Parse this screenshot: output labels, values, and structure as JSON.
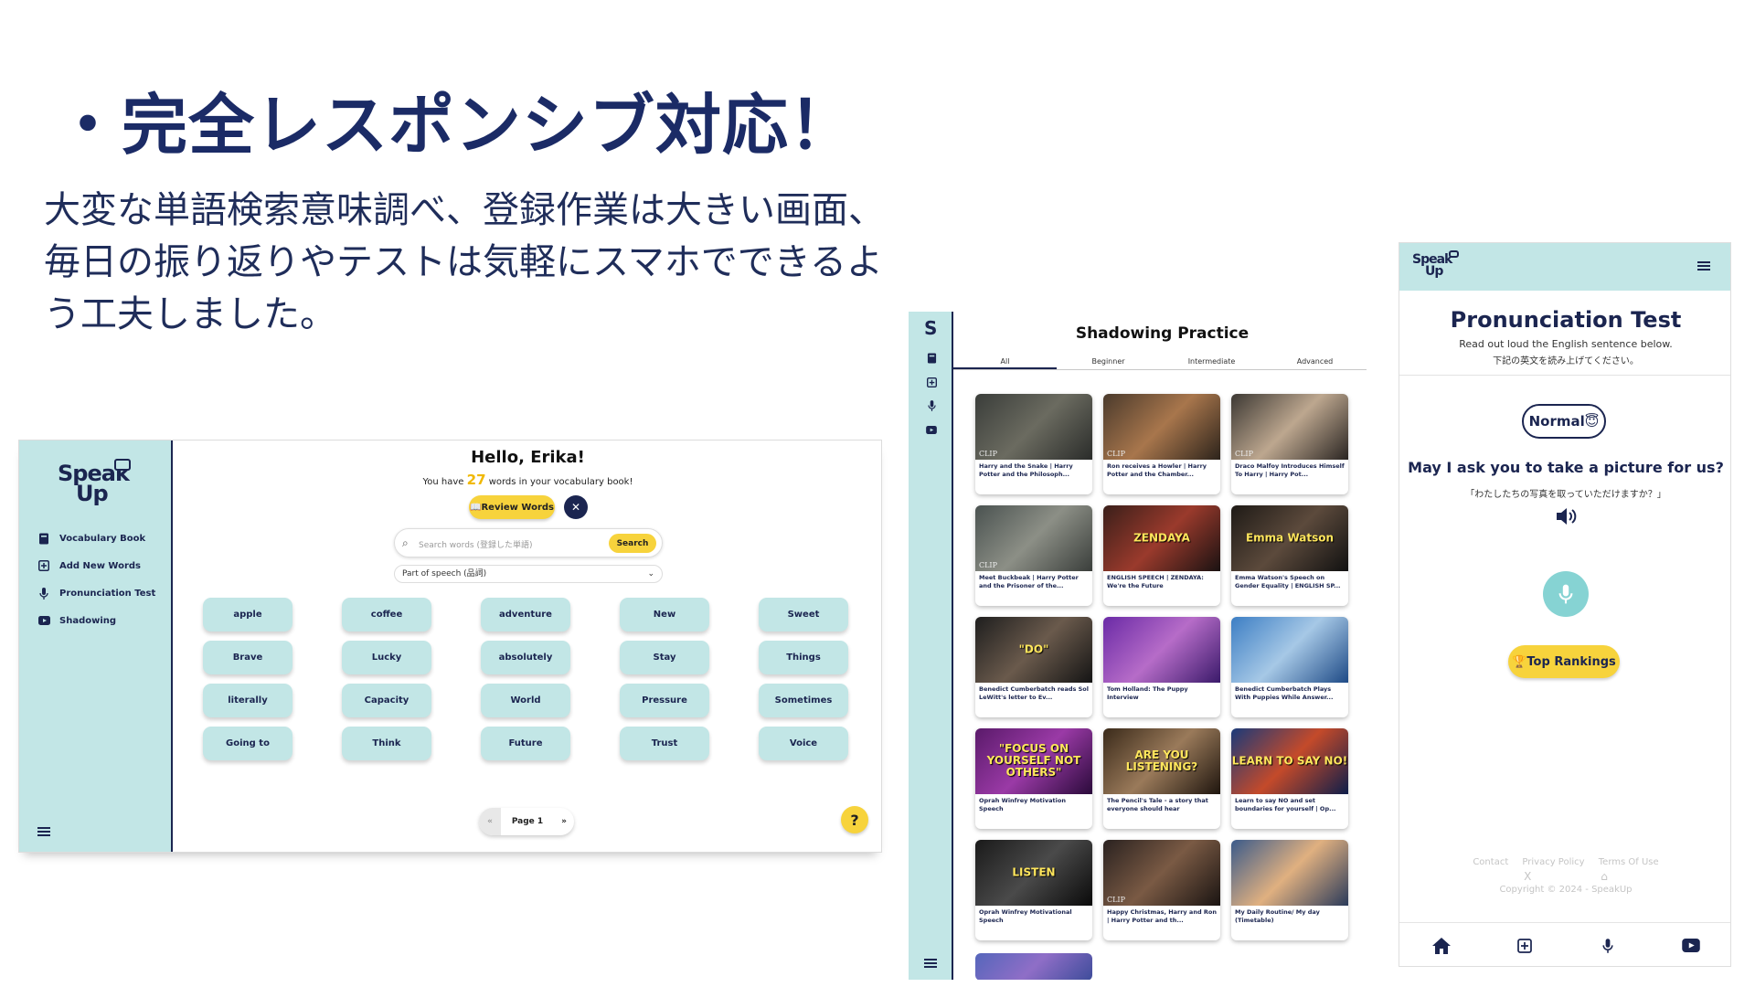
{
  "slide": {
    "title": "・完全レスポンシブ対応！",
    "desc_line1": "大変な単語検索意味調べ、登録作業は大きい画面、",
    "desc_line2": "毎日の振り返りやテストは気軽にスマホでできるよ",
    "desc_line3": "う工夫しました。"
  },
  "colors": {
    "accent_yellow": "#f7d33c",
    "sidebar_teal": "#c2e6e6",
    "navy": "#1b2550"
  },
  "desktop": {
    "logo_line1": "Speak",
    "logo_line2": "Up",
    "nav": [
      {
        "label": "Vocabulary Book",
        "icon": "book-icon"
      },
      {
        "label": "Add New Words",
        "icon": "plus-square-icon"
      },
      {
        "label": "Pronunciation Test",
        "icon": "microphone-icon"
      },
      {
        "label": "Shadowing",
        "icon": "video-icon"
      }
    ],
    "greeting": "Hello, Erika!",
    "vocab_prefix": "You have",
    "vocab_count": "27",
    "vocab_suffix": "words in your vocabulary book!",
    "review_label": "📖Review Words",
    "x_label": "✕",
    "search_placeholder": "Search words (登録した単語)",
    "search_button": "Search",
    "pos_select": "Part of speech (品詞)",
    "words": [
      "apple",
      "coffee",
      "adventure",
      "New",
      "Sweet",
      "Brave",
      "Lucky",
      "absolutely",
      "Stay",
      "Things",
      "literally",
      "Capacity",
      "World",
      "Pressure",
      "Sometimes",
      "Going to",
      "Think",
      "Future",
      "Trust",
      "Voice"
    ],
    "pager_prev": "«",
    "pager_page": "Page 1",
    "pager_next": "»",
    "help": "?"
  },
  "tablet": {
    "side_logo": "S",
    "title": "Shadowing Practice",
    "tabs": [
      "All",
      "Beginner",
      "Intermediate",
      "Advanced"
    ],
    "videos": [
      {
        "title": "Harry and the Snake | Harry Potter and the Philosoph...",
        "clip": "CLIP",
        "overlay": "",
        "bg": "linear-gradient(135deg,#3a3d3a,#6b6b60 50%,#2a2c2a)"
      },
      {
        "title": "Ron receives a Howler | Harry Potter and the Chamber...",
        "clip": "CLIP",
        "overlay": "",
        "bg": "linear-gradient(135deg,#4a3a2c,#a8764c 50%,#2c231b)"
      },
      {
        "title": "Draco Malfoy Introduces Himself To Harry | Harry Pot...",
        "clip": "CLIP",
        "overlay": "",
        "bg": "linear-gradient(135deg,#3c3833,#bda78f 50%,#2a2522)"
      },
      {
        "title": "Meet Buckbeak | Harry Potter and the Prisoner of the...",
        "clip": "CLIP",
        "overlay": "",
        "bg": "linear-gradient(135deg,#4a5250,#8c8f86 50%,#3a3e3b)"
      },
      {
        "title": "ENGLISH SPEECH | ZENDAYA: We're the Future",
        "clip": "",
        "overlay": "ZENDAYA",
        "bg": "linear-gradient(135deg,#3a1f1a,#9a3a2c 50%,#1a1212)"
      },
      {
        "title": "Emma Watson's Speech on Gender Equality | ENGLISH SP...",
        "clip": "",
        "overlay": "Emma Watson",
        "bg": "linear-gradient(135deg,#1e1a16,#5c4a3c 50%,#111)"
      },
      {
        "title": "Benedict Cumberbatch reads Sol LeWitt's letter to Ev...",
        "clip": "",
        "overlay": "\"DO\"",
        "bg": "linear-gradient(135deg,#1e1e1e,#6a5a4c 50%,#141414)"
      },
      {
        "title": "Tom Holland: The Puppy Interview",
        "clip": "",
        "overlay": "",
        "bg": "linear-gradient(135deg,#6a2aa6,#b66cc8 50%,#3a1a6a)"
      },
      {
        "title": "Benedict Cumberbatch Plays With Puppies While Answer...",
        "clip": "",
        "overlay": "",
        "bg": "linear-gradient(135deg,#3c7ec4,#a6c8e6 50%,#1e4a86)"
      },
      {
        "title": "Oprah Winfrey Motivation Speech",
        "clip": "",
        "overlay": "\"FOCUS ON YOURSELF NOT OTHERS\"",
        "bg": "linear-gradient(135deg,#5a1a6a,#9a3aa6 50%,#2a0a3a)"
      },
      {
        "title": "The Pencil's Tale - a story that everyone should hear",
        "clip": "",
        "overlay": "ARE YOU LISTENING?",
        "bg": "linear-gradient(135deg,#3a2a1a,#9a7a5a 50%,#1e150e)"
      },
      {
        "title": "Learn to say NO and set boundaries for yourself | Op...",
        "clip": "",
        "overlay": "LEARN TO SAY NO!",
        "bg": "linear-gradient(135deg,#1a3a7a,#c44a2a 50%,#0e1e4a)"
      },
      {
        "title": "Oprah Winfrey Motivational Speech",
        "clip": "",
        "overlay": "LISTEN",
        "bg": "linear-gradient(135deg,#1a1a1a,#4a4a4a 50%,#0a0a0a)"
      },
      {
        "title": "Happy Christmas, Harry and Ron | Harry Potter and th...",
        "clip": "CLIP",
        "overlay": "",
        "bg": "linear-gradient(135deg,#2a2220,#7a5a44 50%,#1a1412)"
      },
      {
        "title": "My Daily Routine/ My day (Timetable)",
        "clip": "",
        "overlay": "",
        "bg": "linear-gradient(135deg,#3a5a8a,#e0b080 50%,#2a3a5a)"
      }
    ]
  },
  "mobile": {
    "logo_line1": "Speak",
    "logo_line2": "Up",
    "title": "Pronunciation Test",
    "sub_en": "Read out loud the English sentence below.",
    "sub_ja": "下記の英文を読み上げてください。",
    "level": "Normal😇",
    "sentence": "May I ask you to take a picture for us?",
    "sentence_ja": "「わたしたちの写真を取っていただけますか？」",
    "rankings": "🏆Top Rankings",
    "footer_links": [
      "Contact",
      "Privacy Policy",
      "Terms Of Use"
    ],
    "footer_icons": [
      "X",
      "⌂"
    ],
    "copyright": "Copyright © 2024 - SpeakUp"
  }
}
